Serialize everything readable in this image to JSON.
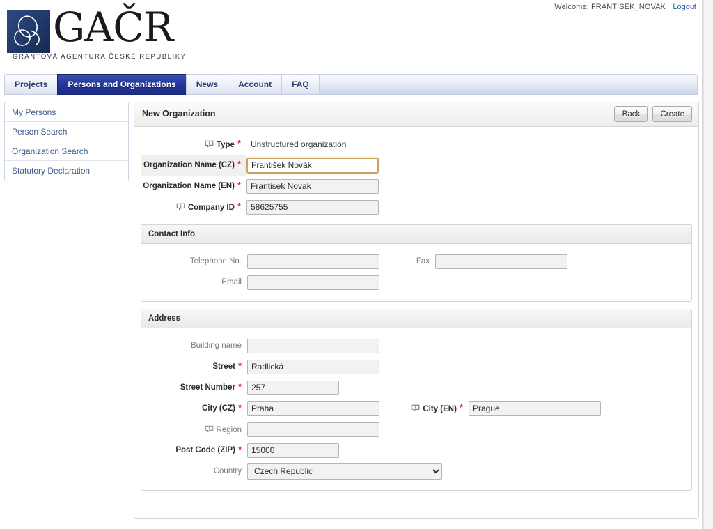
{
  "topbar": {
    "welcome": "Welcome: FRANTISEK_NOVAK",
    "logout": "Logout"
  },
  "brand": {
    "acronym": "GAČR",
    "subtitle": "GRANTOVÁ AGENTURA ČESKÉ REPUBLIKY"
  },
  "tabs": [
    {
      "label": "Projects",
      "active": false
    },
    {
      "label": "Persons and Organizations",
      "active": true
    },
    {
      "label": "News",
      "active": false
    },
    {
      "label": "Account",
      "active": false
    },
    {
      "label": "FAQ",
      "active": false
    }
  ],
  "sidebar": {
    "items": [
      {
        "label": "My Persons"
      },
      {
        "label": "Person Search"
      },
      {
        "label": "Organization Search"
      },
      {
        "label": "Statutory Declaration"
      }
    ]
  },
  "content": {
    "title": "New Organization",
    "back_label": "Back",
    "create_label": "Create"
  },
  "form": {
    "type": {
      "label": "Type",
      "value": "Unstructured organization",
      "required": true,
      "info": true
    },
    "org_name_cz": {
      "label": "Organization Name (CZ)",
      "value": "František Novák",
      "placeholder": "",
      "required": true,
      "focused": true
    },
    "org_name_en": {
      "label": "Organization Name (EN)",
      "value": "Frantisek Novak",
      "placeholder": "",
      "required": true
    },
    "company_id": {
      "label": "Company ID",
      "value": "58625755",
      "placeholder": "",
      "required": true,
      "info": true
    }
  },
  "contact": {
    "title": "Contact Info",
    "telephone": {
      "label": "Telephone No.",
      "value": "",
      "placeholder": ""
    },
    "fax": {
      "label": "Fax",
      "value": "",
      "placeholder": ""
    },
    "email": {
      "label": "Email",
      "value": "",
      "placeholder": ""
    }
  },
  "address": {
    "title": "Address",
    "building": {
      "label": "Building name",
      "value": "",
      "placeholder": ""
    },
    "street": {
      "label": "Street",
      "value": "Radlická",
      "placeholder": "",
      "required": true
    },
    "street_number": {
      "label": "Street Number",
      "value": "257",
      "placeholder": "",
      "required": true
    },
    "city_cz": {
      "label": "City (CZ)",
      "value": "Praha",
      "placeholder": "",
      "required": true
    },
    "city_en": {
      "label": "City (EN)",
      "value": "Prague",
      "placeholder": "",
      "required": true,
      "info": true
    },
    "region": {
      "label": "Region",
      "value": "",
      "placeholder": "",
      "info": true
    },
    "post_code": {
      "label": "Post Code (ZIP)",
      "value": "15000",
      "placeholder": "",
      "required": true
    },
    "country": {
      "label": "Country",
      "value": "Czech Republic",
      "options": [
        "Czech Republic"
      ]
    }
  },
  "colors": {
    "active_tab": "#23379b",
    "tab_text": "#2c3e70",
    "required_star": "#e03131",
    "focus_border": "#c9a45c",
    "link": "#2e5fa3",
    "sidebar_link": "#3c5a8c"
  },
  "icons": {
    "info": "info-bubble-icon",
    "dropdown": "chevron-down-icon"
  }
}
